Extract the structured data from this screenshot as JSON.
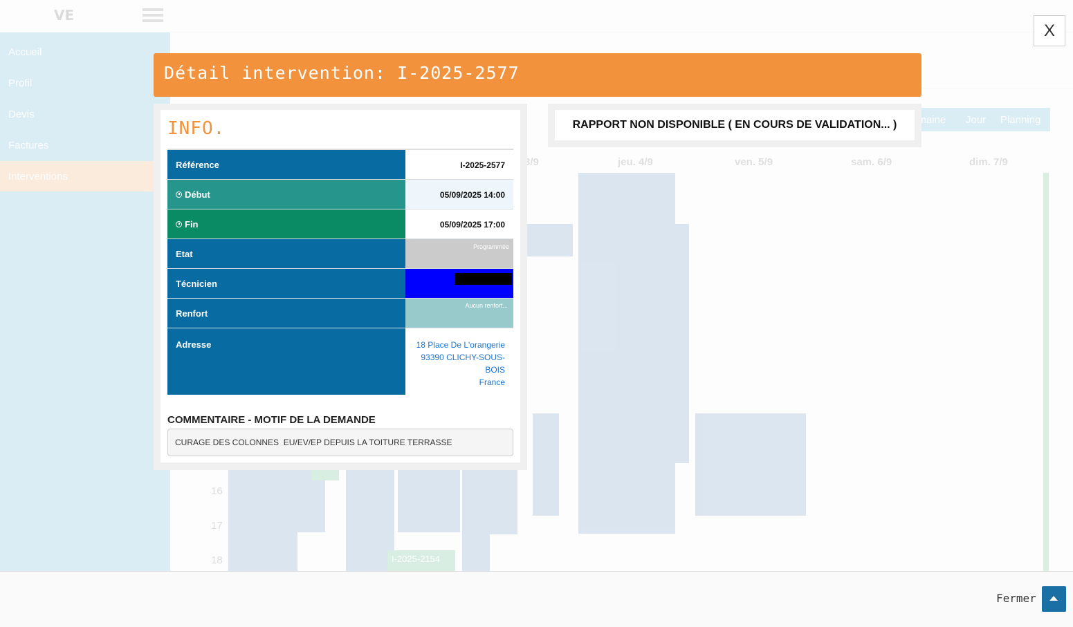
{
  "background": {
    "sidebar": [
      "Accueil",
      "Profil",
      "Devis",
      "Factures",
      "Interventions"
    ],
    "view_tabs": [
      "Semaine",
      "Jour",
      "Planning"
    ],
    "days": [
      "3/9",
      "jeu. 4/9",
      "ven. 5/9",
      "sam. 6/9",
      "dim. 7/9"
    ],
    "hours": [
      "16",
      "17",
      "18"
    ],
    "event_label": "I-2025-2154"
  },
  "modal": {
    "close_label": "X",
    "title": "Détail intervention: I-2025-2577",
    "info_title": "INFO.",
    "rows": {
      "reference": {
        "label": "Référence",
        "value": "I-2025-2577",
        "color": "#086ba2"
      },
      "debut": {
        "label": "Début",
        "value": "05/09/2025 14:00",
        "color": "#26968c"
      },
      "fin": {
        "label": "Fin",
        "value": "05/09/2025 17:00",
        "color": "#0a8b63"
      },
      "etat": {
        "label": "Etat",
        "value": "Programmée",
        "color": "#086ba2"
      },
      "technicien": {
        "label": "Técnicien",
        "value": "",
        "color": "#086ba2"
      },
      "renfort": {
        "label": "Renfort",
        "value": "Aucun renfort...",
        "color": "#086ba2"
      },
      "adresse": {
        "label": "Adresse",
        "line1": "18 Place De L'orangerie",
        "line2": "93390 CLICHY-SOUS-",
        "line3": "BOIS",
        "line4": "France",
        "color": "#086ba2"
      }
    },
    "comment_title": "COMMENTAIRE - MOTIF DE LA DEMANDE",
    "comment_text": "CURAGE DES COLONNES  EU/EV/EP DEPUIS LA TOITURE TERRASSE",
    "rapport_text": "RAPPORT NON DISPONIBLE ( EN COURS DE VALIDATION... )",
    "footer_close": "Fermer"
  }
}
